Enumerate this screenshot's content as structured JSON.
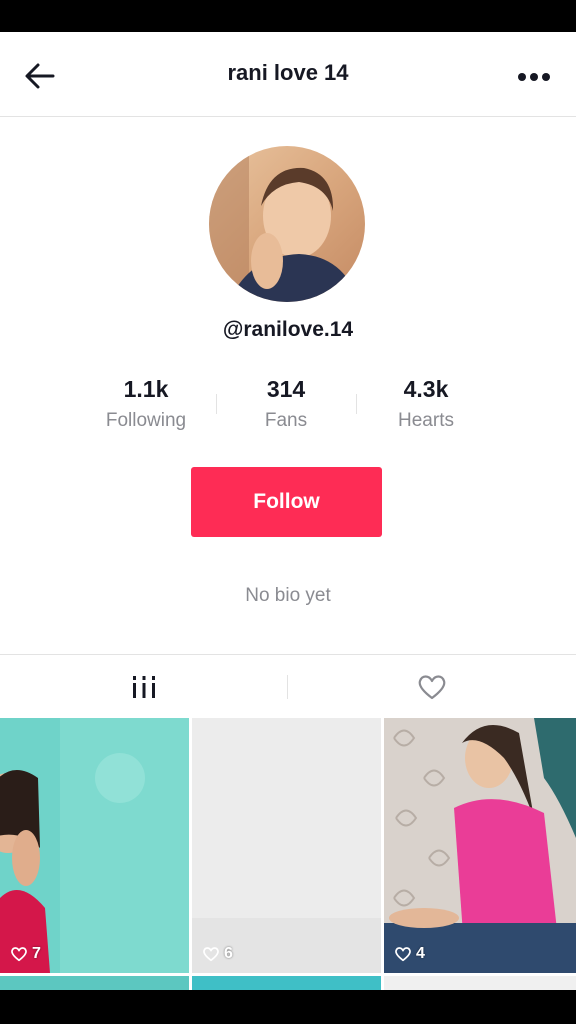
{
  "header": {
    "title": "rani love 14"
  },
  "profile": {
    "handle": "@ranilove.14",
    "bio": "No bio yet"
  },
  "stats": [
    {
      "value": "1.1k",
      "label": "Following"
    },
    {
      "value": "314",
      "label": "Fans"
    },
    {
      "value": "4.3k",
      "label": "Hearts"
    }
  ],
  "actions": {
    "follow_label": "Follow"
  },
  "tabs": [
    {
      "icon": "videos-grid-icon"
    },
    {
      "icon": "heart-icon"
    }
  ],
  "videos": [
    {
      "likes": "7"
    },
    {
      "likes": "6"
    },
    {
      "likes": "4"
    }
  ],
  "colors": {
    "accent": "#fe2c55",
    "text_primary": "#161823",
    "text_secondary": "#8a8b91"
  }
}
